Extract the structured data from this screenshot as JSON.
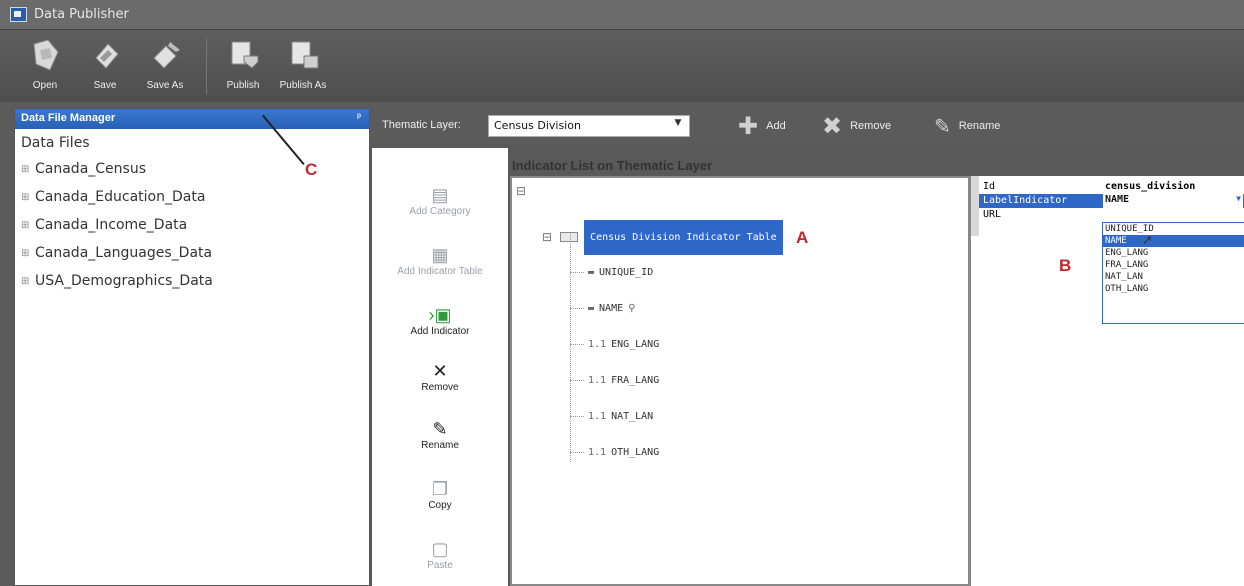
{
  "window": {
    "title": "Data Publisher"
  },
  "toolbar": {
    "buttons": [
      {
        "label": "Open",
        "icon": "open-icon"
      },
      {
        "label": "Save",
        "icon": "save-icon"
      },
      {
        "label": "Save As",
        "icon": "save-as-icon"
      },
      {
        "label": "Publish",
        "icon": "publish-icon"
      },
      {
        "label": "Publish As",
        "icon": "publish-as-icon"
      }
    ]
  },
  "data_file_manager": {
    "title": "Data File Manager",
    "pin": "ᵖ",
    "section": "Data Files",
    "expander": "⊞",
    "items": [
      "Canada_Census",
      "Canada_Education_Data",
      "Canada_Income_Data",
      "Canada_Languages_Data",
      "USA_Demographics_Data"
    ]
  },
  "thematic": {
    "label": "Thematic Layer:",
    "selected": "Census Division",
    "add_label": "Add",
    "remove_label": "Remove",
    "rename_label": "Rename"
  },
  "sidebar_actions": {
    "add_category": "Add Category",
    "add_indicator_table": "Add Indicator Table",
    "add_indicator": "Add Indicator",
    "remove": "Remove",
    "rename": "Rename",
    "copy": "Copy",
    "paste": "Paste"
  },
  "indicator_list": {
    "title": "Indicator List on Thematic Layer",
    "root_expander": "⊟",
    "table_name": "Census Division Indicator Table",
    "indicators": [
      "UNIQUE_ID",
      "NAME",
      "ENG_LANG",
      "FRA_LANG",
      "NAT_LAN",
      "OTH_LANG"
    ]
  },
  "properties": {
    "rows": [
      {
        "key": "Id",
        "value": "census_division"
      },
      {
        "key": "LabelIndicator",
        "value": "NAME"
      },
      {
        "key": "URL",
        "value": ""
      }
    ],
    "dropdown_options": [
      "UNIQUE_ID",
      "NAME",
      "ENG_LANG",
      "FRA_LANG",
      "NAT_LAN",
      "OTH_LANG"
    ],
    "highlighted_option": "NAME"
  },
  "annotations": {
    "a": "A",
    "b": "B",
    "c": "C"
  },
  "colors": {
    "accent": "#2f67c9",
    "marker": "#c0282a",
    "toolbar": "#5b5b5b"
  }
}
